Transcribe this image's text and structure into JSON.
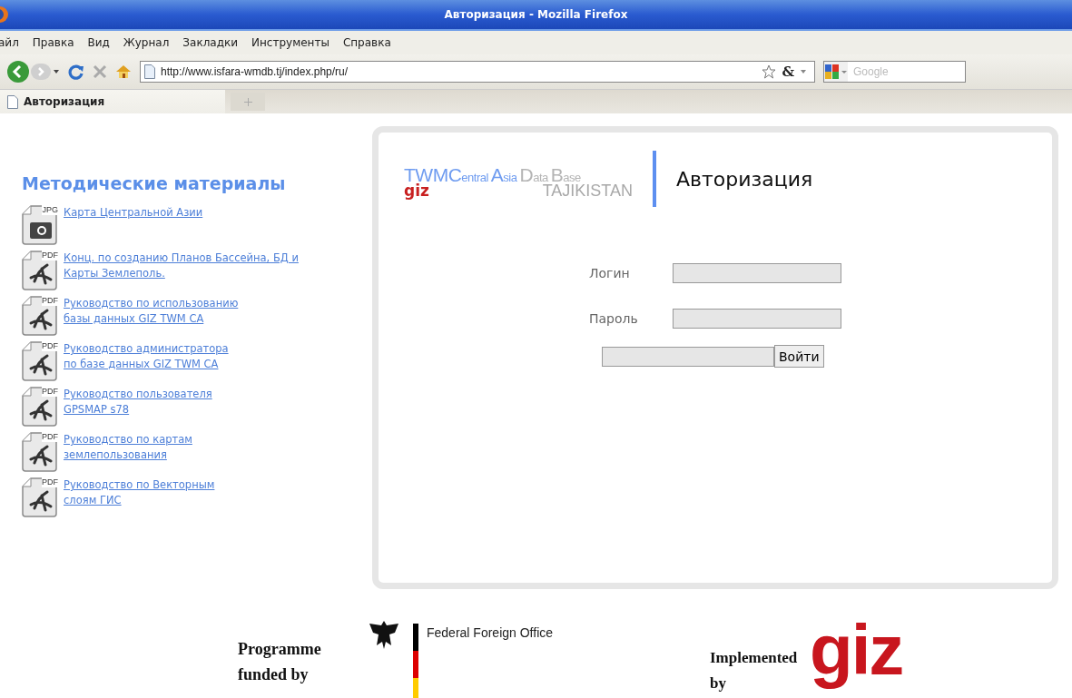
{
  "window": {
    "title": "Авторизация - Mozilla Firefox"
  },
  "menu": [
    "айл",
    "Правка",
    "Вид",
    "Журнал",
    "Закладки",
    "Инструменты",
    "Справка"
  ],
  "address": {
    "value": "http://www.isfara-wmdb.tj/index.php/ru/",
    "extra": "&"
  },
  "search": {
    "placeholder": "Google"
  },
  "tabs": [
    {
      "label": "Авторизация",
      "selected": true
    }
  ],
  "sidebar": {
    "heading": "Методические материалы",
    "items": [
      {
        "kind": "jpg",
        "badge": "JPG",
        "lines": [
          "Карта Центральной Азии"
        ]
      },
      {
        "kind": "pdf",
        "badge": "PDF",
        "lines": [
          "Конц. по созданию Планов Бассейна, БД и",
          "Карты Землеполь."
        ]
      },
      {
        "kind": "pdf",
        "badge": "PDF",
        "lines": [
          "Руководство по использованию",
          "базы данных GIZ TWM CA"
        ]
      },
      {
        "kind": "pdf",
        "badge": "PDF",
        "lines": [
          "Руководство администратора",
          "по базе данных GIZ TWM CA"
        ]
      },
      {
        "kind": "pdf",
        "badge": "PDF",
        "lines": [
          "Руководство пользователя",
          "GPSMAP s78"
        ]
      },
      {
        "kind": "pdf",
        "badge": "PDF",
        "lines": [
          "Руководство по картам",
          "землепользования"
        ]
      },
      {
        "kind": "pdf",
        "badge": "PDF",
        "lines": [
          "Руководство по Векторным",
          "слоям ГИС"
        ]
      }
    ]
  },
  "logo": {
    "words": [
      {
        "initial": "TWMC",
        "rest": "entral",
        "color": "#6f9cf0"
      },
      {
        "initial": "A",
        "rest": "sia",
        "color": "#6f9cf0"
      },
      {
        "initial": "D",
        "rest": "ata",
        "color": "#b4b4b4"
      },
      {
        "initial": "B",
        "rest": "ase",
        "color": "#b4b4b4"
      }
    ],
    "mark": "giz",
    "country": "TAJIKISTAN"
  },
  "login": {
    "title": "Авторизация",
    "fields": [
      {
        "label": "Логин"
      },
      {
        "label": "Пароль"
      }
    ],
    "button": "Войти"
  },
  "footer": {
    "funded": [
      "Programme",
      "funded by"
    ],
    "office": "Federal Foreign Office",
    "implemented": [
      "Implemented",
      "by"
    ],
    "logo": "giz"
  }
}
